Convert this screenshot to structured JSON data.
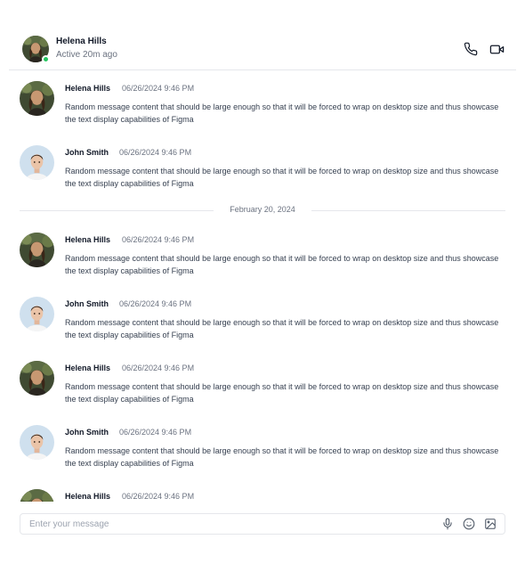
{
  "header": {
    "contact_name": "Helena Hills",
    "status": "Active 20m ago",
    "presence_color": "#22c55e",
    "call_icon": "phone-icon",
    "video_icon": "video-camera-icon"
  },
  "messages": [
    {
      "sender": "Helena Hills",
      "time": "06/26/2024 9:46 PM",
      "text": "Random message content that should be large enough so that it will be forced to wrap on desktop size and thus showcase the text display capabilities of Figma"
    },
    {
      "sender": "John Smith",
      "time": "06/26/2024 9:46 PM",
      "text": "Random message content that should be large enough so that it will be forced to wrap on desktop size and thus showcase the text display capabilities of Figma"
    },
    {
      "sender": "Helena Hills",
      "time": "06/26/2024 9:46 PM",
      "text": "Random message content that should be large enough so that it will be forced to wrap on desktop size and thus showcase the text display capabilities of Figma"
    },
    {
      "sender": "John Smith",
      "time": "06/26/2024 9:46 PM",
      "text": "Random message content that should be large enough so that it will be forced to wrap on desktop size and thus showcase the text display capabilities of Figma"
    },
    {
      "sender": "Helena Hills",
      "time": "06/26/2024 9:46 PM",
      "text": "Random message content that should be large enough so that it will be forced to wrap on desktop size and thus showcase the text display capabilities of Figma"
    },
    {
      "sender": "John Smith",
      "time": "06/26/2024 9:46 PM",
      "text": "Random message content that should be large enough so that it will be forced to wrap on desktop size and thus showcase the text display capabilities of Figma"
    },
    {
      "sender": "Helena Hills",
      "time": "06/26/2024 9:46 PM",
      "text": ""
    }
  ],
  "date_divider": "February 20, 2024",
  "composer": {
    "placeholder": "Enter your message",
    "value": "",
    "mic_icon": "microphone-icon",
    "emoji_icon": "emoji-icon",
    "image_icon": "image-icon"
  }
}
